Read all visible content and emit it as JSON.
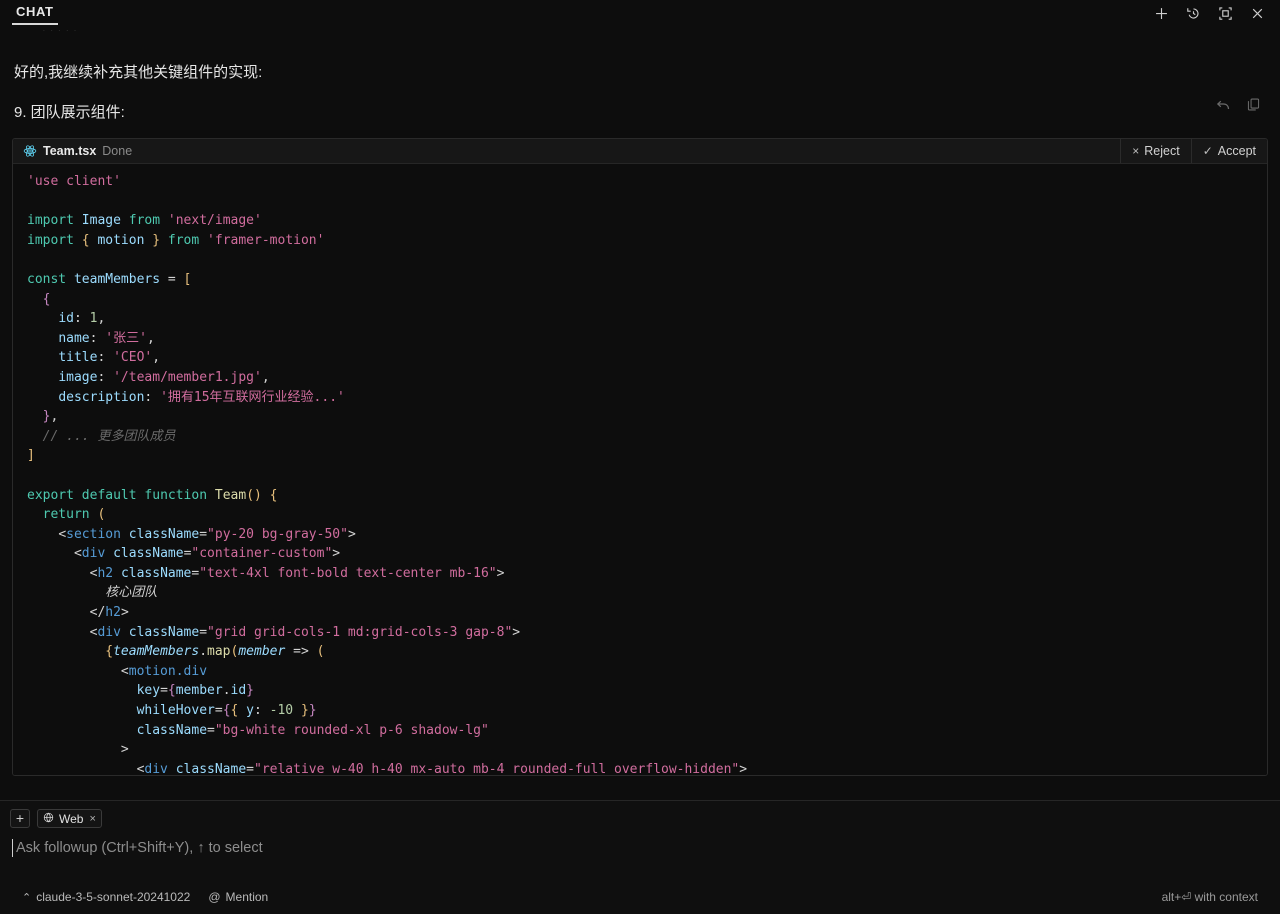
{
  "header": {
    "tab_label": "CHAT",
    "actions": [
      {
        "name": "new-chat-icon",
        "label": "+"
      },
      {
        "name": "history-icon",
        "label": "History"
      },
      {
        "name": "maximize-panel-icon",
        "label": "Maximize"
      },
      {
        "name": "close-icon",
        "label": "Close"
      }
    ]
  },
  "conversation": {
    "message_1": "好的,我继续补充其他关键组件的实现:",
    "message_2": "9. 团队展示组件:",
    "actions": [
      {
        "name": "retry-icon",
        "label": "Retry"
      },
      {
        "name": "copy-icon",
        "label": "Copy"
      }
    ]
  },
  "code_card": {
    "filename": "Team.tsx",
    "status": "Done",
    "reject_label": "Reject",
    "reject_glyph": "×",
    "accept_label": "Accept",
    "accept_glyph": "✓",
    "language": "tsx"
  },
  "code": {
    "lines": [
      "'use client'",
      "",
      "import Image from 'next/image'",
      "import { motion } from 'framer-motion'",
      "",
      "const teamMembers = [",
      "  {",
      "    id: 1,",
      "    name: '张三',",
      "    title: 'CEO',",
      "    image: '/team/member1.jpg',",
      "    description: '拥有15年互联网行业经验...'",
      "  },",
      "  // ... 更多团队成员",
      "]",
      "",
      "export default function Team() {",
      "  return (",
      "    <section className=\"py-20 bg-gray-50\">",
      "      <div className=\"container-custom\">",
      "        <h2 className=\"text-4xl font-bold text-center mb-16\">",
      "          核心团队",
      "        </h2>",
      "        <div className=\"grid grid-cols-1 md:grid-cols-3 gap-8\">",
      "          {teamMembers.map(member => (",
      "            <motion.div",
      "              key={member.id}",
      "              whileHover={{ y: -10 }}",
      "              className=\"bg-white rounded-xl p-6 shadow-lg\"",
      "            >",
      "              <div className=\"relative w-40 h-40 mx-auto mb-4 rounded-full overflow-hidden\">"
    ]
  },
  "composer": {
    "add_context_label": "+",
    "chip_label": "Web",
    "chip_icon": "globe-icon",
    "chip_close": "×",
    "placeholder": "Ask followup (Ctrl+Shift+Y), ↑ to select",
    "input_value": ""
  },
  "statusbar": {
    "model_chevron": "⌃",
    "model_name": "claude-3-5-sonnet-20241022",
    "mention_glyph": "@",
    "mention_label": "Mention",
    "hint": "alt+⏎ with context"
  },
  "colors": {
    "background": "#0d0d0d",
    "panel": "#0f0f0f",
    "border": "#2a2a2a",
    "text": "#e6e6e6",
    "muted": "#8a8a8a",
    "accent_react": "#61dafb",
    "keyword": "#4ec9b0",
    "string": "#d16d9e",
    "variable": "#9cdcfe",
    "number": "#b5cea8",
    "bracket": "#e8c07d",
    "tag": "#569cd6",
    "comment": "#6a6a6a",
    "function": "#dcdcaa"
  }
}
